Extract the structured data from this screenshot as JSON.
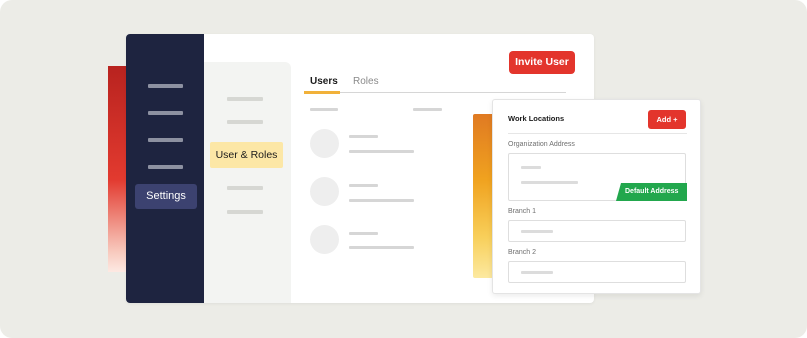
{
  "sidebar": {
    "settings_label": "Settings"
  },
  "subnav": {
    "active_label": "User & Roles"
  },
  "header": {
    "invite_label": "Invite User"
  },
  "tabs": [
    {
      "label": "Users",
      "active": true
    },
    {
      "label": "Roles",
      "active": false
    }
  ],
  "work_locations": {
    "title": "Work Locations",
    "add_label": "Add +",
    "org_address_label": "Organization Address",
    "default_badge": "Default Address",
    "branch1_label": "Branch 1",
    "branch2_label": "Branch 2"
  },
  "colors": {
    "accent_red": "#e3352c",
    "sidebar_navy": "#1e2440",
    "highlight_yellow": "#fce7a6",
    "tab_underline": "#f1b13a",
    "badge_green": "#22a74d"
  },
  "icons": [
    "plus-icon"
  ]
}
